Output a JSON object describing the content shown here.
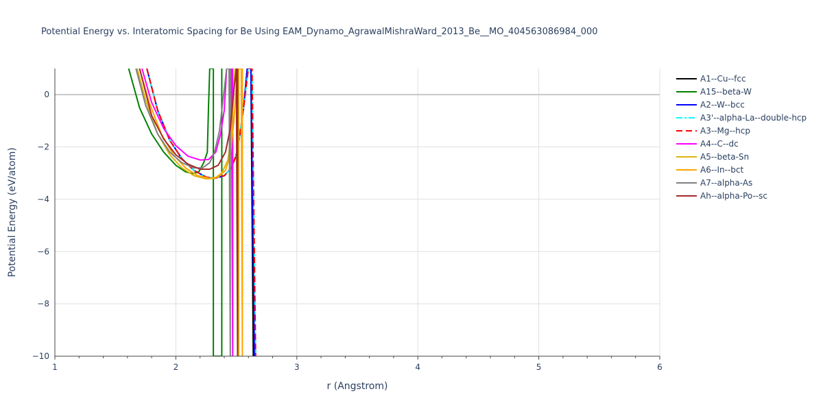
{
  "chart_data": {
    "type": "line",
    "title": "Potential Energy vs. Interatomic Spacing for Be Using EAM_Dynamo_AgrawalMishraWard_2013_Be__MO_404563086984_000",
    "xlabel": "r (Angstrom)",
    "ylabel": "Potential Energy (eV/atom)",
    "xlim": [
      1,
      6
    ],
    "ylim": [
      -10,
      1
    ],
    "x_ticks": [
      1,
      2,
      3,
      4,
      5,
      6
    ],
    "y_ticks": [
      0,
      -2,
      -4,
      -6,
      -8,
      -10
    ],
    "y_tick_labels": [
      "0",
      "−2",
      "−4",
      "−6",
      "−8",
      "−10"
    ],
    "grid": true,
    "legend_position": "right",
    "series": [
      {
        "name": "A1--Cu--fcc",
        "color": "#000000",
        "dash": "solid",
        "x": [
          1.76,
          1.85,
          1.95,
          2.05,
          2.15,
          2.25,
          2.32,
          2.4,
          2.46,
          2.5,
          2.53,
          2.56,
          2.59,
          2.62,
          2.64,
          2.66
        ],
        "y": [
          1.0,
          -0.6,
          -1.75,
          -2.45,
          -2.9,
          -3.15,
          -3.2,
          -3.1,
          -2.8,
          -2.3,
          -1.5,
          -0.5,
          1.0,
          1.0,
          -10,
          -10
        ]
      },
      {
        "name": "A15--beta-W",
        "color": "#008000",
        "dash": "solid",
        "x": [
          1.61,
          1.7,
          1.8,
          1.9,
          2.0,
          2.08,
          2.14,
          2.19,
          2.23,
          2.26,
          2.27,
          2.28,
          2.29,
          2.3,
          2.31,
          2.31,
          2.38,
          2.38
        ],
        "y": [
          1.0,
          -0.5,
          -1.5,
          -2.2,
          -2.7,
          -2.95,
          -3.02,
          -2.95,
          -2.6,
          -2.2,
          -0.5,
          1.0,
          1.0,
          1.0,
          1.0,
          -10,
          -10,
          1.0
        ]
      },
      {
        "name": "A2--W--bcc",
        "color": "#0000ff",
        "dash": "solid",
        "x": [
          1.76,
          1.85,
          1.95,
          2.05,
          2.15,
          2.25,
          2.32,
          2.4,
          2.46,
          2.5,
          2.53,
          2.56,
          2.59,
          2.62,
          2.65,
          2.66
        ],
        "y": [
          1.0,
          -0.6,
          -1.75,
          -2.45,
          -2.9,
          -3.15,
          -3.2,
          -3.1,
          -2.8,
          -2.3,
          -1.5,
          -0.5,
          1.0,
          1.0,
          -10,
          -10
        ]
      },
      {
        "name": "A3'--alpha-La--double-hcp",
        "color": "#00ffff",
        "dash": "dashdot",
        "x": [
          1.76,
          1.85,
          1.95,
          2.05,
          2.15,
          2.25,
          2.32,
          2.4,
          2.46,
          2.5,
          2.53,
          2.56,
          2.6,
          2.63,
          2.66,
          2.66
        ],
        "y": [
          1.0,
          -0.6,
          -1.75,
          -2.45,
          -2.9,
          -3.15,
          -3.2,
          -3.1,
          -2.8,
          -2.3,
          -1.5,
          -0.5,
          1.0,
          1.0,
          -10,
          -10
        ]
      },
      {
        "name": "A3--Mg--hcp",
        "color": "#ff0000",
        "dash": "dash",
        "x": [
          1.76,
          1.85,
          1.95,
          2.05,
          2.15,
          2.25,
          2.32,
          2.4,
          2.46,
          2.5,
          2.53,
          2.56,
          2.6,
          2.63,
          2.66,
          2.66
        ],
        "y": [
          1.0,
          -0.6,
          -1.75,
          -2.45,
          -2.9,
          -3.15,
          -3.2,
          -3.1,
          -2.8,
          -2.3,
          -1.5,
          -0.5,
          1.0,
          1.0,
          -10,
          -10
        ]
      },
      {
        "name": "A4--C--dc",
        "color": "#ff00ff",
        "dash": "solid",
        "x": [
          1.72,
          1.8,
          1.9,
          2.0,
          2.1,
          2.2,
          2.27,
          2.33,
          2.37,
          2.4,
          2.42,
          2.44,
          2.46,
          2.47,
          2.47
        ],
        "y": [
          1.0,
          -0.3,
          -1.3,
          -1.95,
          -2.35,
          -2.5,
          -2.48,
          -2.2,
          -1.5,
          -0.6,
          1.0,
          1.0,
          1.0,
          -10,
          1.0
        ]
      },
      {
        "name": "A5--beta-Sn",
        "color": "#dbb40c",
        "dash": "solid",
        "x": [
          1.68,
          1.75,
          1.85,
          1.95,
          2.05,
          2.15,
          2.25,
          2.32,
          2.38,
          2.43,
          2.46,
          2.49,
          2.51,
          2.52,
          2.52
        ],
        "y": [
          1.0,
          -0.2,
          -1.5,
          -2.3,
          -2.8,
          -3.1,
          -3.22,
          -3.2,
          -3.0,
          -2.5,
          -1.5,
          1.0,
          1.0,
          -10,
          1.0
        ]
      },
      {
        "name": "A6--In--bct",
        "color": "#ffa500",
        "dash": "solid",
        "x": [
          1.7,
          1.78,
          1.88,
          1.98,
          2.08,
          2.18,
          2.28,
          2.35,
          2.41,
          2.45,
          2.48,
          2.51,
          2.54,
          2.55,
          2.55
        ],
        "y": [
          1.0,
          -0.3,
          -1.5,
          -2.3,
          -2.8,
          -3.1,
          -3.2,
          -3.15,
          -2.9,
          -2.3,
          -1.0,
          1.0,
          1.0,
          -10,
          1.0
        ]
      },
      {
        "name": "A7--alpha-As",
        "color": "#808080",
        "dash": "solid",
        "x": [
          1.67,
          1.75,
          1.85,
          1.95,
          2.05,
          2.15,
          2.22,
          2.28,
          2.32,
          2.36,
          2.39,
          2.42,
          2.44,
          2.45,
          2.45
        ],
        "y": [
          1.0,
          -0.4,
          -1.5,
          -2.2,
          -2.6,
          -2.8,
          -2.8,
          -2.6,
          -2.2,
          -1.4,
          -0.2,
          1.0,
          1.0,
          -10,
          1.0
        ]
      },
      {
        "name": "Ah--alpha-Po--sc",
        "color": "#a52a2a",
        "dash": "solid",
        "x": [
          1.7,
          1.8,
          1.9,
          2.0,
          2.1,
          2.2,
          2.28,
          2.35,
          2.41,
          2.45,
          2.48,
          2.5,
          2.51,
          2.51
        ],
        "y": [
          1.0,
          -0.8,
          -1.7,
          -2.3,
          -2.65,
          -2.85,
          -2.85,
          -2.7,
          -2.2,
          -1.3,
          0.2,
          1.0,
          -10,
          1.0
        ]
      }
    ]
  }
}
